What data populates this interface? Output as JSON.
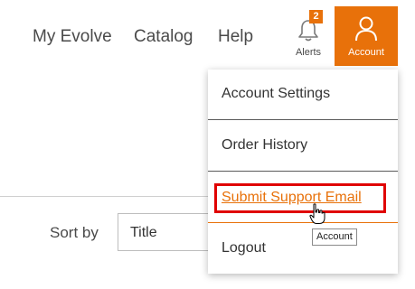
{
  "nav": {
    "my_evolve": "My Evolve",
    "catalog": "Catalog",
    "help": "Help",
    "alerts": {
      "label": "Alerts",
      "count": "2",
      "icon": "bell-icon"
    },
    "account": {
      "label": "Account",
      "icon": "user-icon"
    }
  },
  "account_menu": {
    "items": [
      {
        "label": "Account Settings"
      },
      {
        "label": "Order History"
      },
      {
        "label": "Submit Support Email"
      },
      {
        "label": "Logout"
      }
    ]
  },
  "sort": {
    "label": "Sort by",
    "selected": "Title"
  },
  "tooltip": "Account",
  "colors": {
    "accent": "#e8710a",
    "highlight": "#e00000",
    "text": "#4a4a4a"
  }
}
